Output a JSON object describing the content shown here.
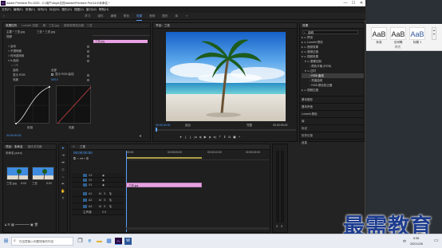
{
  "window": {
    "title": "Adobe Premiere Pro 2020 - C:\\用户\\Ahys\\文档\\Adobe\\Premiere Pro\\14.0\\未命名 *",
    "app_icon": "Pr",
    "controls": [
      "—",
      "☐",
      "✕"
    ]
  },
  "menu": [
    "文件(F)",
    "编辑(E)",
    "剪辑(C)",
    "序列(S)",
    "标记(M)",
    "图形(G)",
    "视图(V)",
    "窗口(W)",
    "帮助(H)"
  ],
  "workspaces": {
    "items": [
      "学习",
      "组件",
      "编辑",
      "颜色",
      "效果",
      "音频",
      "图形",
      "库"
    ],
    "active_index": 4
  },
  "effect_controls": {
    "tabs": [
      "效果控件",
      "Lumetri 范围",
      "源：三亚.jpg",
      "音频剪辑混合器：三亚"
    ],
    "clip_label": "主要 * 三亚.jpg",
    "seq_label": "三亚 * 三亚.jpg",
    "section": "视频",
    "clip_bar": "三亚.jpg",
    "rows": [
      {
        "label": "运动"
      },
      {
        "label": "不透明度"
      },
      {
        "label": "时间重映射"
      },
      {
        "label": "fx  曲线"
      },
      {
        "label": "○ □ ✎"
      },
      {
        "label": "曲线"
      },
      {
        "label": "显示 RGB"
      },
      {
        "label": "全部"
      },
      {
        "label": "亮度"
      }
    ],
    "link_label": "显示 RGB 曲线",
    "value_label": "000.0",
    "footer_labels": [
      "色相",
      "亮度"
    ],
    "timecode": "00:00:00:00"
  },
  "program_monitor": {
    "tab": "节目：三亚",
    "timecode_left": "00:00:00:00",
    "fit": "适合",
    "quality": "完整",
    "timecode_right": "00:00:05:00",
    "buttons": [
      "marker-icon",
      "in-icon",
      "out-icon",
      "go-in-icon",
      "step-back-icon",
      "play-icon",
      "step-forward-icon",
      "go-out-icon",
      "lift-icon",
      "extract-icon",
      "camera-icon",
      "compare-icon",
      "settings-icon"
    ]
  },
  "effects_panel": {
    "tab": "效果",
    "search_placeholder": "曲线",
    "tree": [
      {
        "label": "预设",
        "indent": 0
      },
      {
        "label": "Lumetri 预设",
        "indent": 0
      },
      {
        "label": "音频效果",
        "indent": 0
      },
      {
        "label": "音频过渡",
        "indent": 0
      },
      {
        "label": "视频效果",
        "indent": 0
      },
      {
        "label": "图像控制",
        "indent": 1
      },
      {
        "label": "颜色平衡 (RGB)",
        "indent": 2
      },
      {
        "label": "过时",
        "indent": 1
      },
      {
        "label": "RGB 曲线",
        "indent": 2
      },
      {
        "label": "亮度曲线",
        "indent": 2
      },
      {
        "label": "RGB 颜色校正器",
        "indent": 2
      },
      {
        "label": "视频过渡",
        "indent": 0
      }
    ],
    "sections": [
      "基本图形",
      "基本声音",
      "Lumetri 颜色",
      "库",
      "标记",
      "历史记录",
      "信息"
    ]
  },
  "project_panel": {
    "tabs": [
      "项目：未命名",
      "媒体浏览器"
    ],
    "file_label": "未命名.prproj",
    "items": [
      {
        "name": "三亚.jpg",
        "duration": "5:00"
      },
      {
        "name": "三亚",
        "duration": "5:00"
      }
    ]
  },
  "timeline": {
    "tab": "三亚",
    "timecode": "00:00:00:00",
    "ruler_marks": [
      ":00:00",
      "00:00:05:00",
      "00:00:10:00",
      "00:00:15:00"
    ],
    "video_tracks": [
      "V3",
      "V2",
      "V1"
    ],
    "audio_tracks": [
      "A1",
      "A2",
      "A3"
    ],
    "master": "主声道",
    "master_value": "0.0",
    "clip_label": "三亚.jpg"
  },
  "audio_meter": {
    "scale": [
      "0",
      "-6",
      "-12",
      "-18",
      "-24",
      "-30",
      "-36",
      "-42",
      "-48",
      "-54"
    ],
    "labels": [
      "S",
      "S"
    ]
  },
  "background_app": {
    "ribbon_labels": [
      "标准",
      "无间隔",
      "标题 1"
    ],
    "ribbon_caption": "样式"
  },
  "watermark": "最需教育",
  "taskbar": {
    "search_placeholder": "在这里输入你要搜索的内容",
    "time": "9:36",
    "date": "2021/12/6",
    "lang": "中"
  },
  "colors": {
    "accent": "#5aa0ff",
    "clip_pink": "#e7a1e3",
    "premiere_purple": "#2a0a40"
  }
}
